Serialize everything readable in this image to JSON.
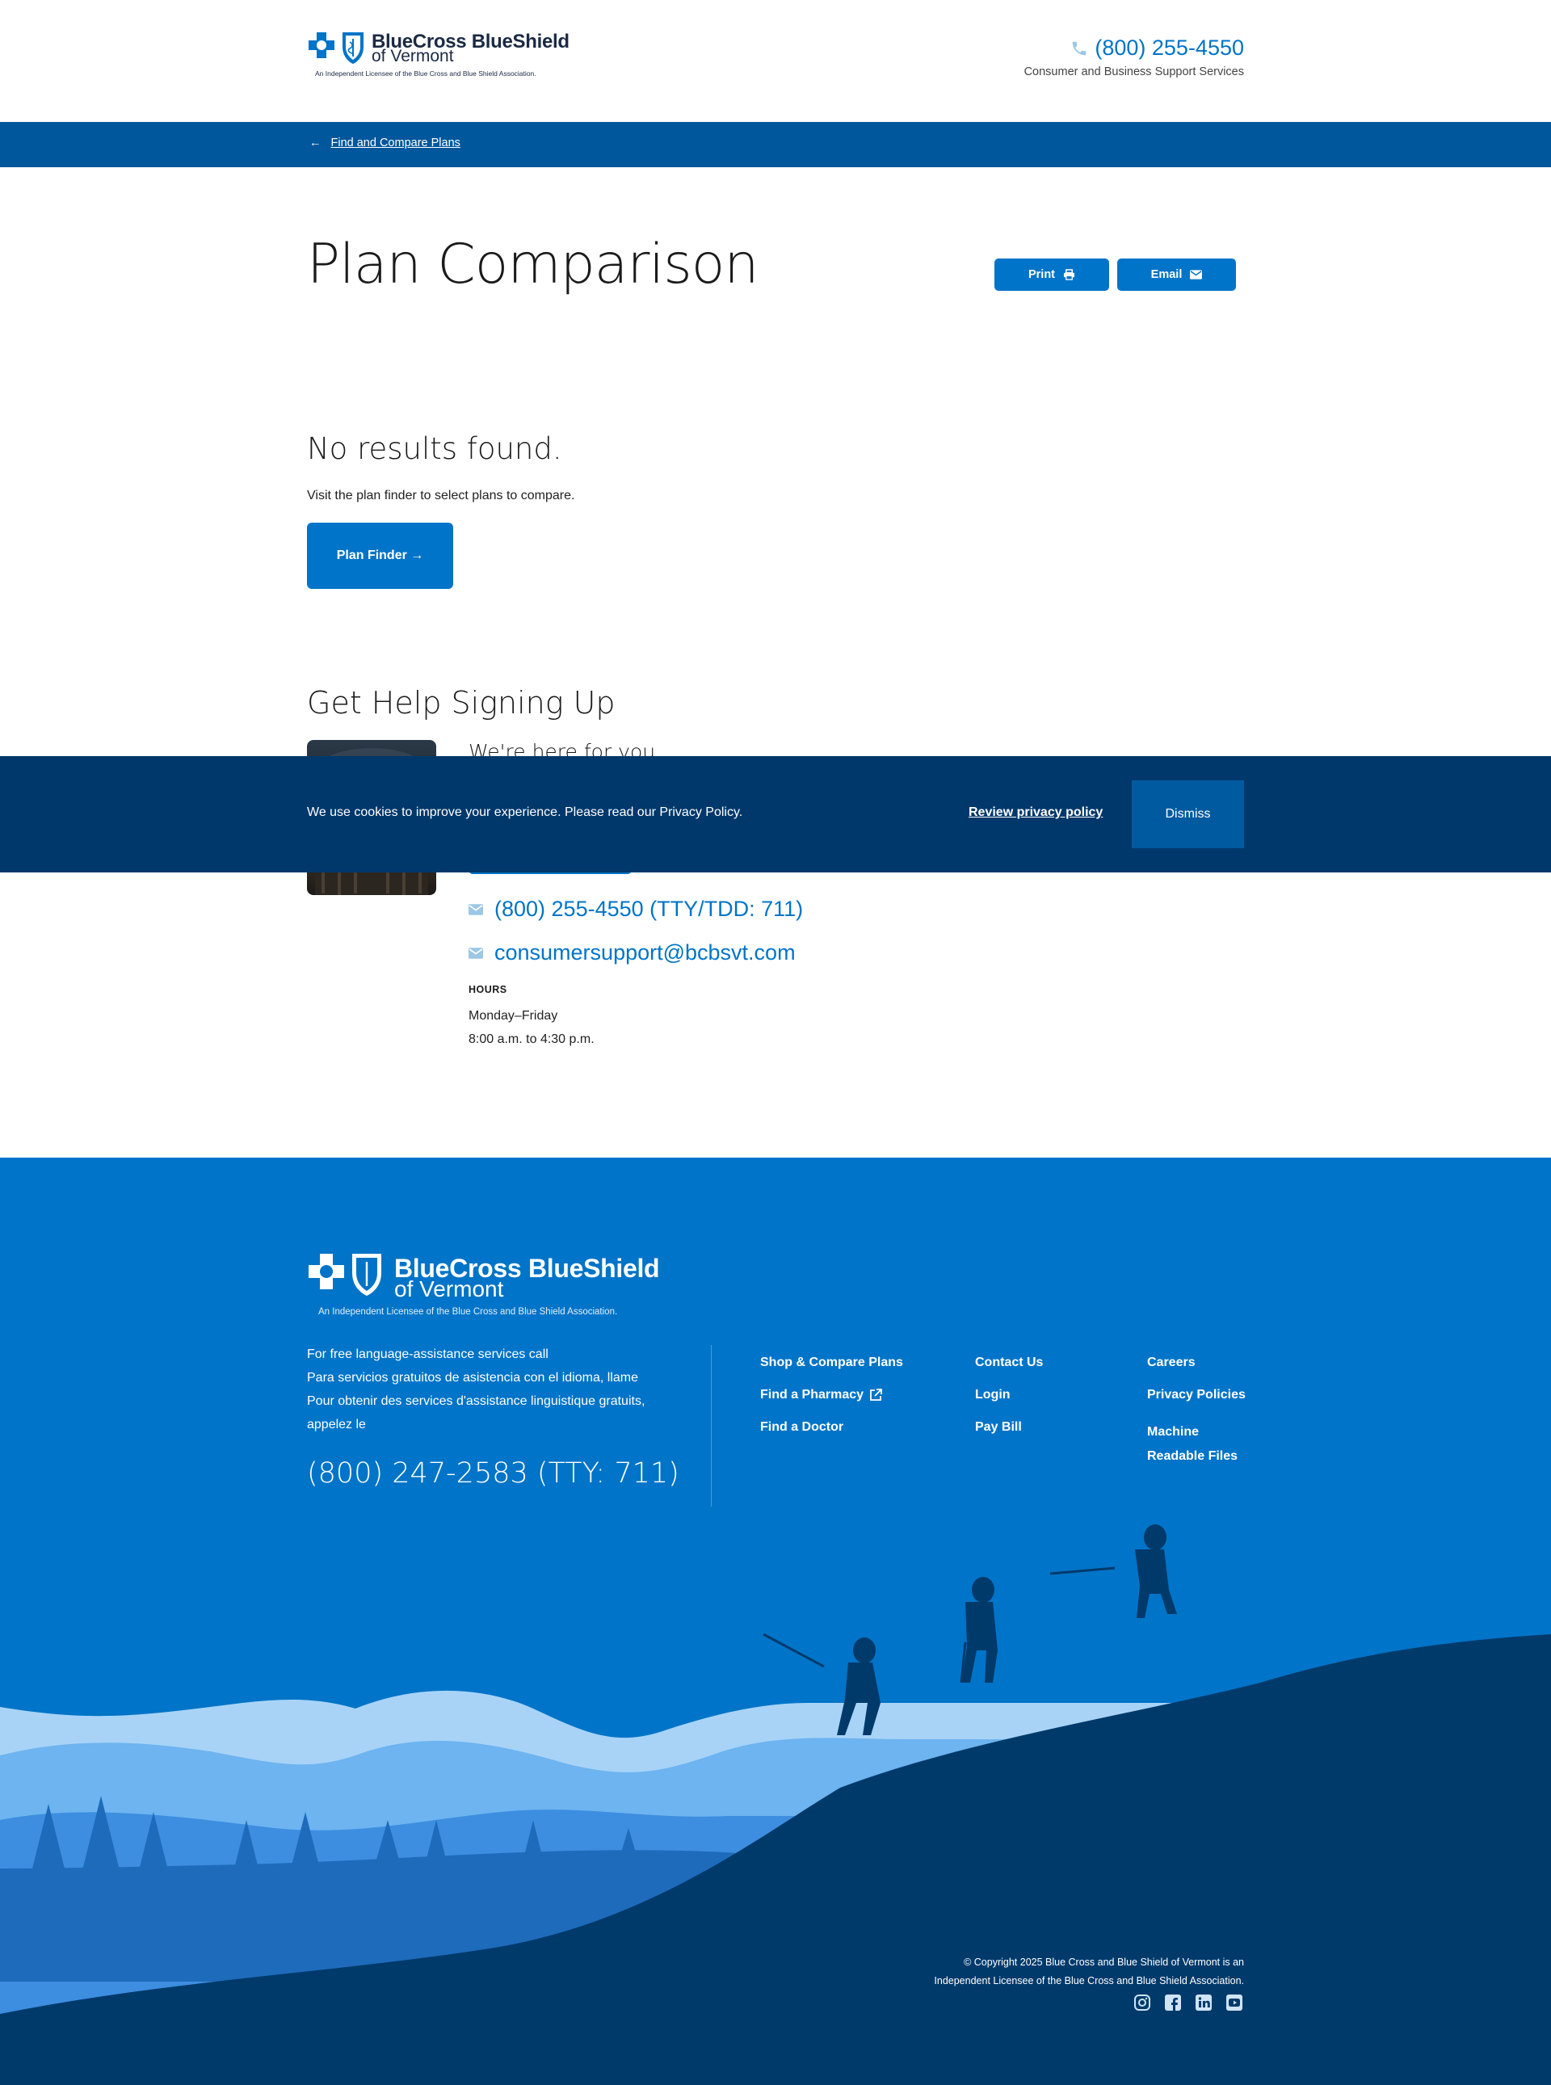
{
  "header": {
    "logo": {
      "name": "BlueCross BlueShield",
      "sub": "of Vermont",
      "tagline": "An Independent Licensee of the Blue Cross and Blue Shield Association."
    },
    "phone": "(800) 255-4550",
    "phone_sub": "Consumer and Business Support Services",
    "phone_icon": "phone-icon"
  },
  "breadcrumb": {
    "label": "Find and Compare Plans",
    "icon": "arrow-left-icon"
  },
  "page": {
    "title": "Plan Comparison",
    "print_label": "Print",
    "email_label": "Email"
  },
  "results": {
    "heading": "No results found.",
    "subtext": "Visit the plan finder to select plans to compare.",
    "button_label": "Plan Finder →"
  },
  "help": {
    "title": "Get Help Signing Up",
    "intro": "We're here for you.",
    "phone": "(800) 255-4550 (TTY/TDD: 711)",
    "email": "consumersupport@bcbsvt.com",
    "hours_label": "HOURS",
    "hours_days": "Monday–Friday",
    "hours_time": "8:00 a.m. to 4:30 p.m."
  },
  "cookie": {
    "text": "We use cookies to improve your experience. Please read our Privacy Policy.",
    "link_label": "Review privacy policy",
    "dismiss_label": "Dismiss"
  },
  "footer": {
    "logo": {
      "name": "BlueCross BlueShield",
      "sub": "of Vermont",
      "tagline": "An Independent Licensee of the Blue Cross and Blue Shield Association."
    },
    "language_lines": [
      "For free language-assistance services call",
      "Para servicios gratuitos de asistencia con el idioma, llame",
      "Pour obtenir des services d'assistance linguistique gratuits, appelez le"
    ],
    "phone": "(800) 247-2583 (TTY: 711)",
    "links": {
      "col1": [
        "Shop & Compare Plans",
        "Find a Pharmacy",
        "Find a Doctor"
      ],
      "col2": [
        "Contact Us",
        "Login",
        "Pay Bill"
      ],
      "col3": [
        "Careers",
        "Privacy Policies",
        "Machine Readable Files"
      ]
    },
    "copyright_line1": "© Copyright 2025 Blue Cross and Blue Shield of Vermont is an",
    "copyright_line2": "Independent Licensee of the Blue Cross and Blue Shield Association.",
    "social": [
      "instagram-icon",
      "facebook-icon",
      "linkedin-icon",
      "youtube-icon"
    ]
  },
  "colors": {
    "primary": "#0074c8",
    "nav_bar": "#00579b",
    "cookie_bg": "#00386b",
    "footer_bg": "#0074c8",
    "footer_dark": "#003a6b"
  }
}
